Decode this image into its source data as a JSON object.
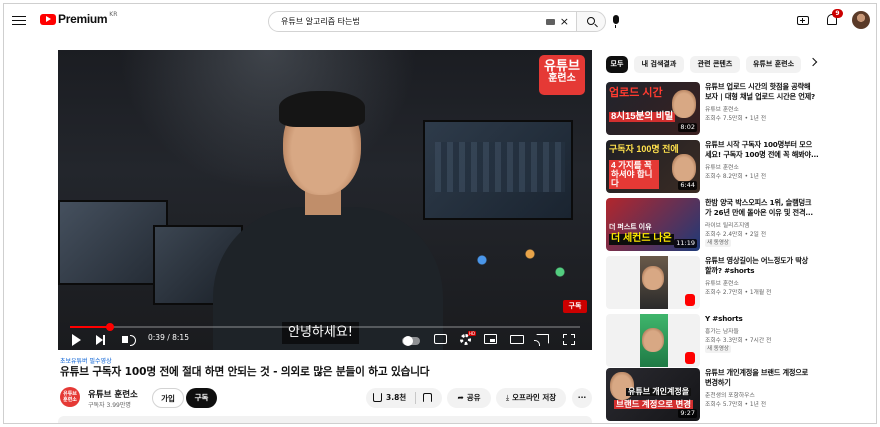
{
  "header": {
    "brand": "Premium",
    "country": "KR",
    "search_query": "유튜브 알고리즘 타는법",
    "clear_icon": "×",
    "notification_count": "9",
    "icons": [
      "menu-icon",
      "search-icon",
      "mic-icon",
      "create-icon",
      "bell-icon",
      "account-avatar"
    ]
  },
  "player": {
    "badge_line1": "유튜브",
    "badge_line2": "훈련소",
    "subscribe_watermark": "구독",
    "caption": "안녕하세요!",
    "time": "0:39 / 8:15",
    "progress": 0.079,
    "colors": {
      "progress": "#ff0000",
      "badge": "#e53935"
    }
  },
  "video": {
    "hashtags": "초보유튜버 필수영상",
    "title": "유튜브 구독자 100명 전에 절대 하면 안되는 것 - 의외로 많은 분들이 하고 있습니다",
    "channel_avatar_text": "유튜브\n훈련소",
    "channel_name": "유튜브 훈련소",
    "subscribers": "구독자 3.99만명",
    "join_label": "가입",
    "subscribe_label": "구독",
    "like_count": "3.8천",
    "share_label": "공유",
    "offline_label": "오프라인 저장",
    "more_label": "···"
  },
  "chips": [
    "모두",
    "내 검색결과",
    "관련 콘텐츠",
    "유튜브 훈련소"
  ],
  "recommendations": [
    {
      "title_line1": "유튜브 업로드 시간의 핫점을 공략해",
      "title_line2": "보자 | 대형 채널 업로드 시간은 언제?",
      "channel": "유튜브 훈련소",
      "meta": "조회수 7.5만회 • 1년 전",
      "duration": "8:02",
      "thumb_text1": "업로드 시간",
      "thumb_text2": "8시15분의 비밀",
      "badge": ""
    },
    {
      "title_line1": "유튜브 시작 구독자 100명부터 모으",
      "title_line2": "세요! 구독자 100명 전에 꼭 해봐야...",
      "channel": "유튜브 훈련소",
      "meta": "조회수 8.2만회 • 1년 전",
      "duration": "6:44",
      "thumb_text1": "구독자 100명 전에",
      "thumb_text2": "4 가지를 꼭 하셔야 합니다",
      "badge": ""
    },
    {
      "title_line1": "한밤 양국 박스오피스 1위, 슬램덩크",
      "title_line2": "가 26년 만에 돌아온 이유 및 전격...",
      "channel": "라이브 릴리즈지엠",
      "meta": "조회수 2.4만회 • 2일 전",
      "duration": "11:19",
      "thumb_text1": "더 퍼스트 이유",
      "thumb_text2": "더 세컨드 나온",
      "badge": "새 동영상"
    },
    {
      "title_line1": "유튜브 영상길이는 어느정도가 딱상",
      "title_line2": "할까? #shorts",
      "channel": "유튜브 훈련소",
      "meta": "조회수 2.7만회 • 1개월 전",
      "duration": "",
      "thumb_text1": "",
      "thumb_text2": "",
      "badge": ""
    },
    {
      "title_line1": "Y #shorts",
      "title_line2": "",
      "channel": "흥가는 남자들",
      "meta": "조회수 3.3만회 • 7시간 전",
      "duration": "",
      "thumb_text1": "",
      "thumb_text2": "",
      "badge": "새 동영상"
    },
    {
      "title_line1": "유튜브 개인계정을 브랜드 계정으로",
      "title_line2": "변경하기",
      "channel": "춘천생의 포항하우스",
      "meta": "조회수 5.7만회 • 1년 전",
      "duration": "9:27",
      "thumb_text1": "유튜브 개인계정을",
      "thumb_text2": "브랜드 계정으로 변경",
      "badge": ""
    }
  ]
}
